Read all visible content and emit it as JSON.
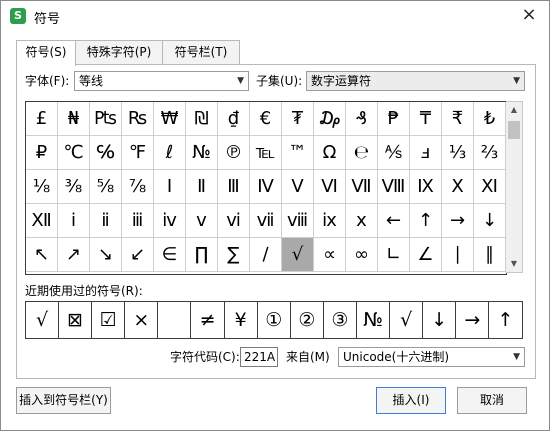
{
  "dialog": {
    "app_icon": "S",
    "title": "符号",
    "close_icon": "×"
  },
  "tabs": [
    {
      "label": "符号(S)",
      "active": true
    },
    {
      "label": "特殊字符(P)",
      "active": false
    },
    {
      "label": "符号栏(T)",
      "active": false
    }
  ],
  "font": {
    "label": "字体(F):",
    "value": "等线"
  },
  "subset": {
    "label": "子集(U):",
    "value": "数字运算符"
  },
  "symbols": [
    [
      "£",
      "₦",
      "₧",
      "₨",
      "₩",
      "₪",
      "₫",
      "€",
      "₮",
      "₯",
      "₰",
      "₱",
      "₸",
      "₹",
      "₺"
    ],
    [
      "₽",
      "℃",
      "℅",
      "℉",
      "ℓ",
      "№",
      "℗",
      "℡",
      "™",
      "Ω",
      "℮",
      "⅍",
      "ⅎ",
      "⅓",
      "⅔"
    ],
    [
      "⅛",
      "⅜",
      "⅝",
      "⅞",
      "Ⅰ",
      "Ⅱ",
      "Ⅲ",
      "Ⅳ",
      "Ⅴ",
      "Ⅵ",
      "Ⅶ",
      "Ⅷ",
      "Ⅸ",
      "Ⅹ",
      "Ⅺ"
    ],
    [
      "Ⅻ",
      "ⅰ",
      "ⅱ",
      "ⅲ",
      "ⅳ",
      "ⅴ",
      "ⅵ",
      "ⅶ",
      "ⅷ",
      "ⅸ",
      "ⅹ",
      "←",
      "↑",
      "→",
      "↓"
    ],
    [
      "↖",
      "↗",
      "↘",
      "↙",
      "∈",
      "∏",
      "∑",
      "∕",
      "√",
      "∝",
      "∞",
      "∟",
      "∠",
      "∣",
      "∥"
    ]
  ],
  "selected_symbol": "√",
  "recent": {
    "label": "近期使用过的符号(R):",
    "items": [
      "√",
      "⊠",
      "☑",
      "×",
      "",
      "≠",
      "¥",
      "①",
      "②",
      "③",
      "№",
      "√",
      "↓",
      "→",
      "↑"
    ]
  },
  "char_code": {
    "label": "字符代码(C):",
    "value": "221A"
  },
  "from": {
    "label": "来自(M)",
    "value": "Unicode(十六进制)"
  },
  "buttons": {
    "insert_to_bar": "插入到符号栏(Y)",
    "insert": "插入(I)",
    "cancel": "取消"
  },
  "colors": {
    "selected_cell": "#a9a9a9",
    "app_icon": "#2f9e4c",
    "primary_border": "#3c7fd6"
  }
}
